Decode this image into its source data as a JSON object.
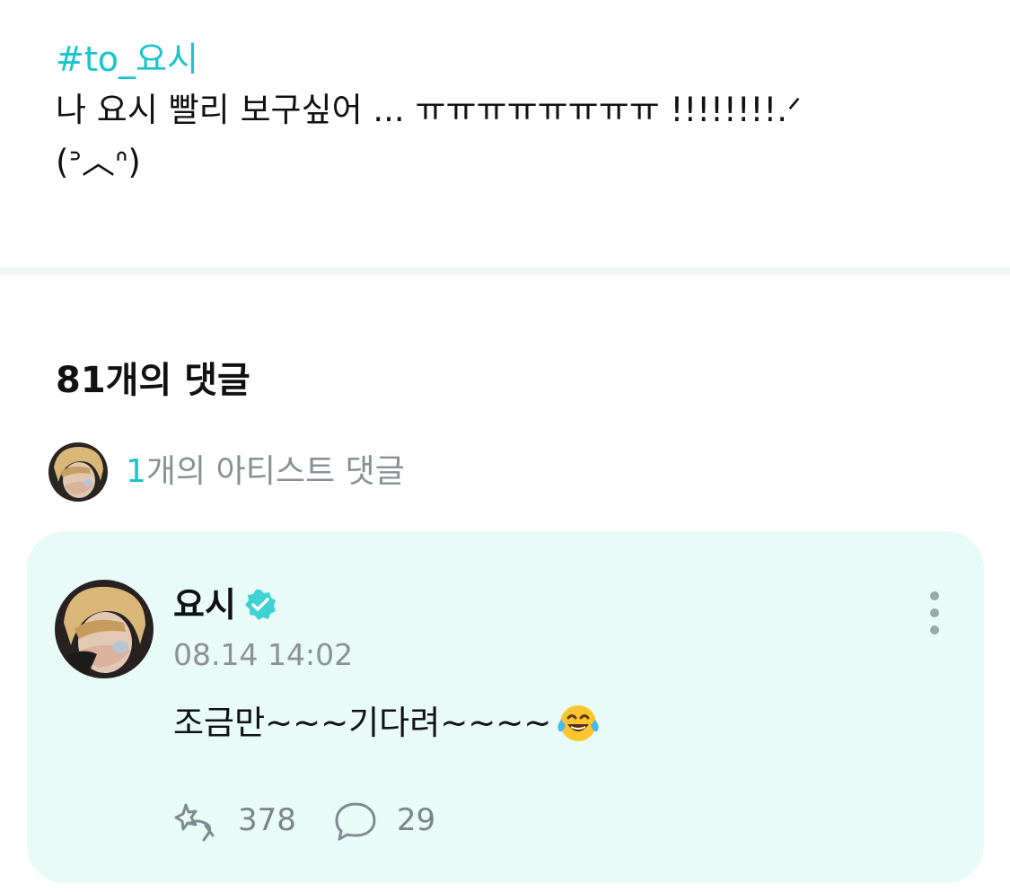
{
  "post": {
    "hashtag": "#to_요시",
    "body": "나 요시 빨리 보구싶어 ... ㅠㅠㅠㅠㅠㅠㅠㅠ !!!!!!!!.ᐟ\n(ᐣ︿ᐢ)"
  },
  "comments": {
    "heading": "81개의 댓글",
    "artist_summary": {
      "count": "1",
      "label": "개의 아티스트 댓글",
      "avatar": "artist-avatar"
    }
  },
  "comment": {
    "author": "요시",
    "verified_icon": "verified-badge-icon",
    "timestamp": "08.14 14:02",
    "text": "조금만~~~기다려~~~~",
    "emoji": "face-with-tears-of-joy",
    "likes": "378",
    "replies": "29",
    "like_icon": "heart-hand-icon",
    "reply_icon": "speech-bubble-icon",
    "more_icon": "more-vertical-icon"
  },
  "colors": {
    "accent": "#18c5cc",
    "card_background": "#e8fbf7",
    "muted_text": "#8d9195"
  }
}
